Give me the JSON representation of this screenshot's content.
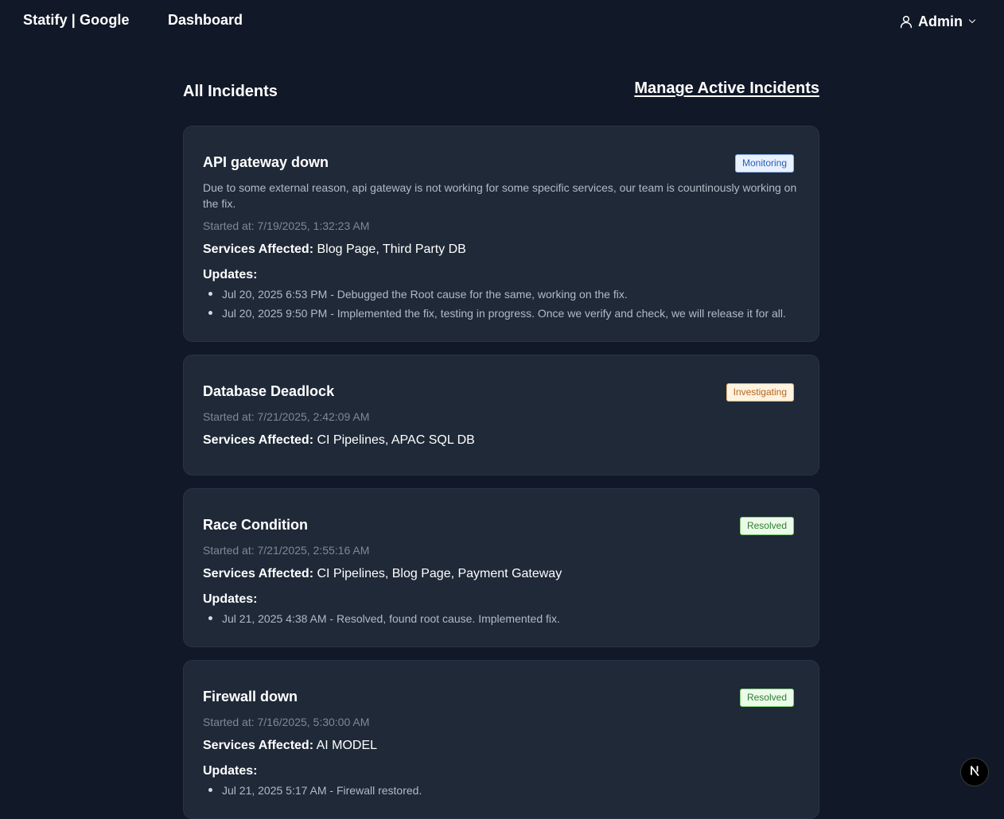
{
  "nav": {
    "brand": "Statify | Google",
    "dashboard_label": "Dashboard",
    "user_label": "Admin",
    "user_icon": "user-icon",
    "chevron_icon": "chevron-down-icon"
  },
  "header": {
    "title": "All Incidents",
    "manage_link": "Manage Active Incidents"
  },
  "labels": {
    "services_affected": "Services Affected:",
    "updates": "Updates:"
  },
  "incidents": [
    {
      "title": "API gateway down",
      "status": "Monitoring",
      "description": "Due to some external reason, api gateway is not working for some specific services, our team is countinously working on the fix.",
      "started": "Started at: 7/19/2025, 1:32:23 AM",
      "services": "Blog Page, Third Party DB",
      "updates": [
        "Jul 20, 2025 6:53 PM - Debugged the Root cause for the same, working on the fix.",
        "Jul 20, 2025 9:50 PM - Implemented the fix, testing in progress. Once we verify and check, we will release it for all."
      ]
    },
    {
      "title": "Database Deadlock",
      "status": "Investigating",
      "started": "Started at: 7/21/2025, 2:42:09 AM",
      "services": "CI Pipelines, APAC SQL DB"
    },
    {
      "title": "Race Condition",
      "status": "Resolved",
      "started": "Started at: 7/21/2025, 2:55:16 AM",
      "services": "CI Pipelines, Blog Page, Payment Gateway",
      "updates": [
        "Jul 21, 2025 4:38 AM - Resolved, found root cause. Implemented fix."
      ]
    },
    {
      "title": "Firewall down",
      "status": "Resolved",
      "started": "Started at: 7/16/2025, 5:30:00 AM",
      "services": "AI MODEL",
      "updates": [
        "Jul 21, 2025 5:17 AM - Firewall restored."
      ]
    }
  ],
  "dev_badge": {
    "letter": "N",
    "icon": "nextjs-icon"
  }
}
